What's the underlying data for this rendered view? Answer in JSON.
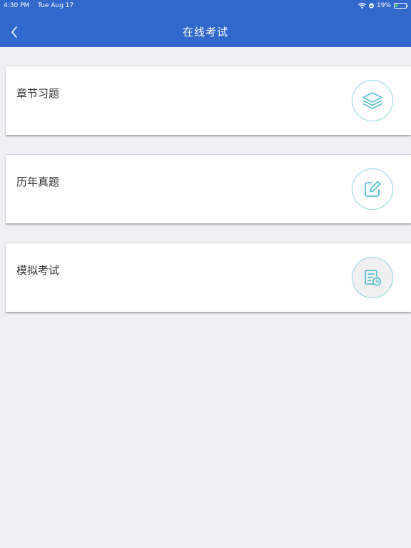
{
  "status_bar": {
    "time": "4:30 PM",
    "date": "Tue Aug 17",
    "battery": "19%",
    "battery_level": 0.19
  },
  "header": {
    "title": "在线考试",
    "back_icon": "chevron-left-icon"
  },
  "colors": {
    "header_bg": "#3168cc",
    "page_bg": "#efeff4",
    "icon_accent": "#5bbfd3"
  },
  "menu": {
    "items": [
      {
        "label": "章节习题",
        "icon": "layers-icon"
      },
      {
        "label": "历年真题",
        "icon": "edit-icon"
      },
      {
        "label": "模拟考试",
        "icon": "exam-clock-icon"
      }
    ]
  }
}
